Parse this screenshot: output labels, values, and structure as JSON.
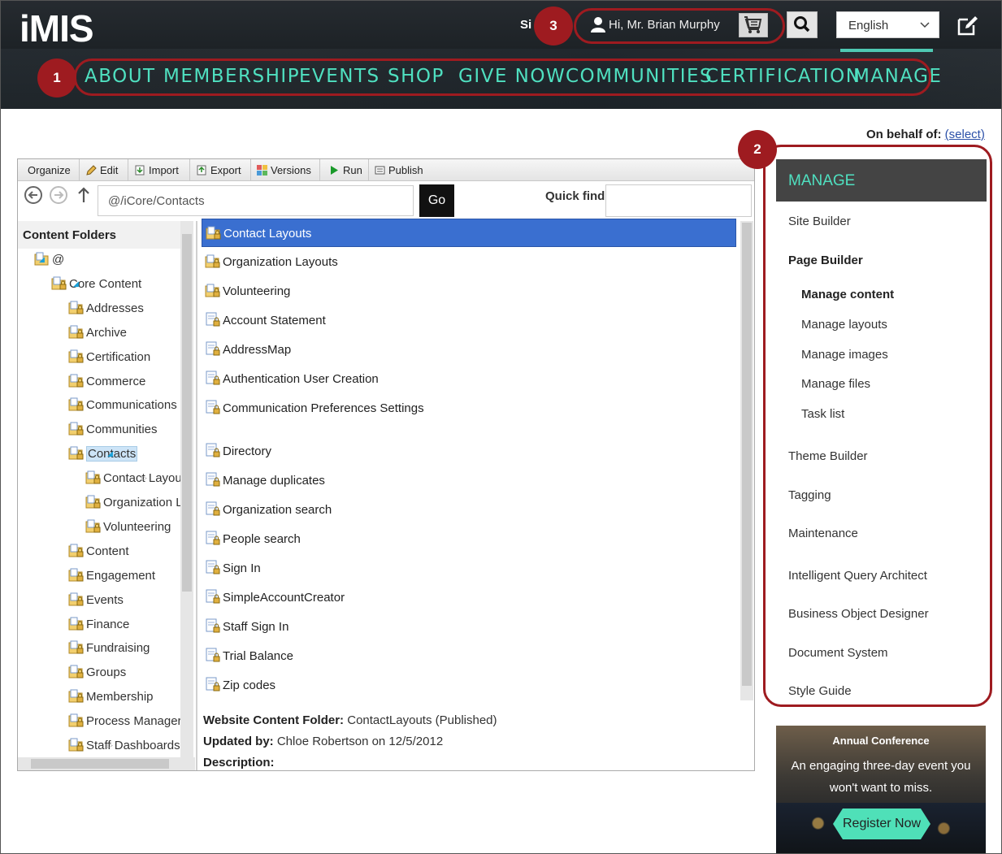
{
  "header": {
    "logo": "iMIS",
    "sign_partial": "Si",
    "user_greeting": "Hi, Mr. Brian Murphy",
    "language": "English",
    "nav": [
      "ABOUT",
      "MEMBERSHIP",
      "EVENTS",
      "SHOP",
      "GIVE NOW",
      "COMMUNITIES",
      "CERTIFICATION",
      "MANAGE"
    ],
    "active_nav": "MANAGE"
  },
  "callouts": [
    "1",
    "2",
    "3"
  ],
  "behalf": {
    "label": "On behalf of:",
    "link": "(select)"
  },
  "toolbar": [
    "Organize",
    "Edit",
    "Import",
    "Export",
    "Versions",
    "Run",
    "Publish"
  ],
  "path": {
    "value": "@/iCore/Contacts",
    "go": "Go",
    "quick_find_label": "Quick find"
  },
  "tree": {
    "header": "Content Folders",
    "rows": [
      "@",
      "Core Content",
      "Addresses",
      "Archive",
      "Certification",
      "Commerce",
      "Communications",
      "Communities",
      "Contacts",
      "Contact Layouts",
      "Organization Layouts",
      "Volunteering",
      "Content",
      "Engagement",
      "Events",
      "Finance",
      "Fundraising",
      "Groups",
      "Membership",
      "Process Manager",
      "Staff Dashboards"
    ],
    "selected": "Contacts"
  },
  "list": {
    "items": [
      "Contact Layouts",
      "Organization Layouts",
      "Volunteering",
      "Account Statement",
      "AddressMap",
      "Authentication User Creation",
      "Communication Preferences Settings",
      "Directory",
      "Manage duplicates",
      "Organization search",
      "People search",
      "Sign In",
      "SimpleAccountCreator",
      "Staff Sign In",
      "Trial Balance",
      "Zip codes"
    ],
    "selected": "Contact Layouts"
  },
  "details": {
    "folder_label": "Website Content Folder:",
    "folder_value": "ContactLayouts (Published)",
    "updated_label": "Updated by:",
    "updated_value": "Chloe Robertson on 12/5/2012",
    "description_label": "Description:"
  },
  "sidebar": {
    "title": "MANAGE",
    "items": [
      "Site Builder",
      "Page Builder",
      "Manage content",
      "Manage layouts",
      "Manage images",
      "Manage files",
      "Task list",
      "Theme Builder",
      "Tagging",
      "Maintenance",
      "Intelligent Query Architect",
      "Business Object Designer",
      "Document System",
      "Style Guide"
    ]
  },
  "promo": {
    "title": "Annual Conference",
    "text": "An engaging three-day event you won't want to miss.",
    "button": "Register Now"
  },
  "colors": {
    "accent": "#4fe0c0",
    "callout": "#9e1b20",
    "selection": "#3a6fd0"
  }
}
